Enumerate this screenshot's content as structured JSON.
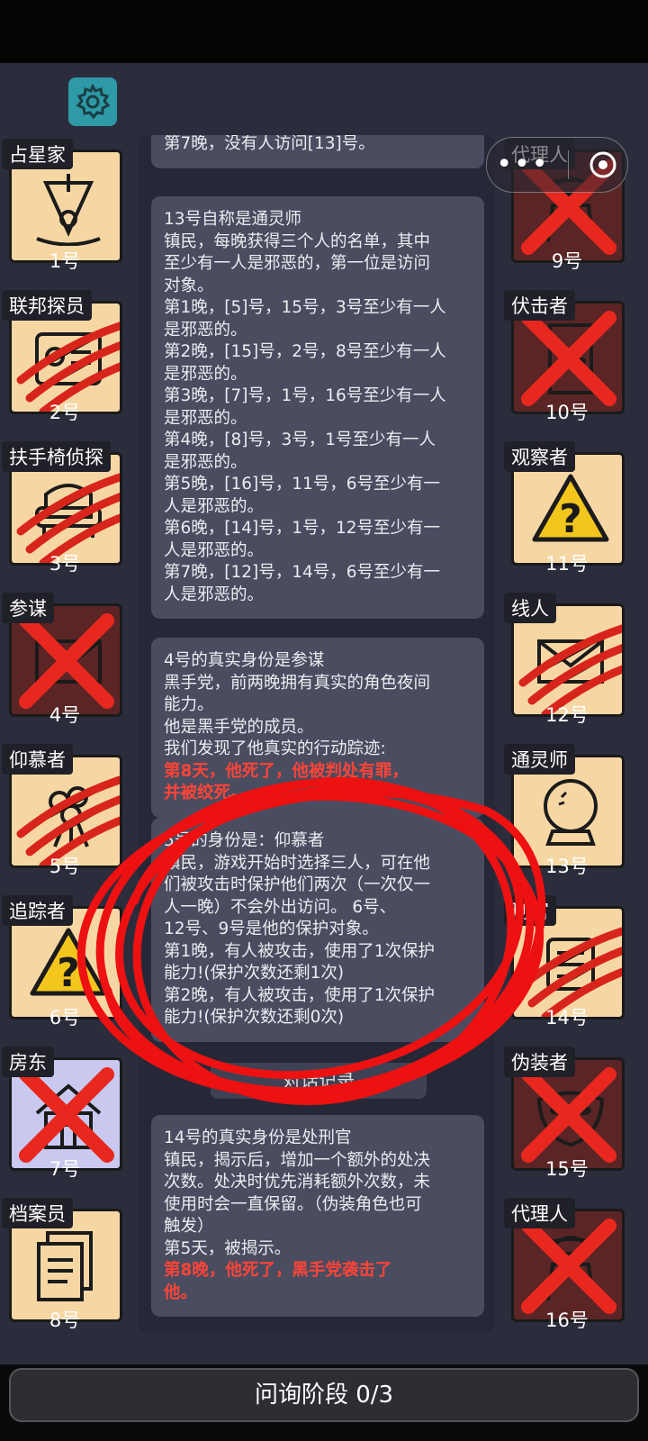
{
  "header": {
    "settings_icon": "gear-icon",
    "capsule_more": "•••",
    "capsule_close_icon": "target-close-icon"
  },
  "left_players": [
    {
      "role": "占星家",
      "number": "1号",
      "icon": "sextant-icon",
      "state": "alive"
    },
    {
      "role": "联邦探员",
      "number": "2号",
      "icon": "id-card-icon",
      "state": "clawed"
    },
    {
      "role": "扶手椅侦探",
      "number": "3号",
      "icon": "armchair-icon",
      "state": "clawed"
    },
    {
      "role": "参谋",
      "number": "4号",
      "icon": "envelope-icon",
      "state": "dead"
    },
    {
      "role": "仰慕者",
      "number": "5号",
      "icon": "flowers-icon",
      "state": "clawed"
    },
    {
      "role": "追踪者",
      "number": "6号",
      "icon": "warning-icon",
      "state": "alive"
    },
    {
      "role": "房东",
      "number": "7号",
      "icon": "house-icon",
      "state": "dead"
    },
    {
      "role": "档案员",
      "number": "8号",
      "icon": "documents-icon",
      "state": "alive"
    }
  ],
  "right_players": [
    {
      "role": "代理人",
      "number": "9号",
      "icon": "agent-icon",
      "state": "dead"
    },
    {
      "role": "伏击者",
      "number": "10号",
      "icon": "door-icon",
      "state": "dead"
    },
    {
      "role": "观察者",
      "number": "11号",
      "icon": "warning-icon",
      "state": "alive"
    },
    {
      "role": "线人",
      "number": "12号",
      "icon": "envelope-icon",
      "state": "clawed"
    },
    {
      "role": "通灵师",
      "number": "13号",
      "icon": "crystal-ball-icon",
      "state": "alive"
    },
    {
      "role": "刑官",
      "number": "14号",
      "icon": "scroll-icon",
      "state": "clawed"
    },
    {
      "role": "伪装者",
      "number": "15号",
      "icon": "mask-icon",
      "state": "dead"
    },
    {
      "role": "代理人",
      "number": "16号",
      "icon": "agent-icon",
      "state": "dead"
    }
  ],
  "log": {
    "msg0": {
      "lines": [
        "第7晚，没有人访问[13]号。"
      ]
    },
    "msg1": {
      "lines": [
        "13号自称是通灵师",
        "镇民，每晚获得三个人的名单，其中",
        "至少有一人是邪恶的，第一位是访问",
        "对象。",
        "第1晚，[5]号，15号，3号至少有一人",
        "是邪恶的。",
        "第2晚，[15]号，2号，8号至少有一人",
        "是邪恶的。",
        "第3晚，[7]号，1号，16号至少有一人",
        "是邪恶的。",
        "第4晚，[8]号，3号，1号至少有一人",
        "是邪恶的。",
        "第5晚，[16]号，11号，6号至少有一",
        "人是邪恶的。",
        "第6晚，[14]号，1号，12号至少有一",
        "人是邪恶的。",
        "第7晚，[12]号，14号，6号至少有一",
        "人是邪恶的。"
      ]
    },
    "msg2": {
      "lines": [
        "4号的真实身份是参谋",
        "黑手党，前两晚拥有真实的角色夜间",
        "能力。",
        "他是黑手党的成员。",
        "我们发现了他真实的行动踪迹:"
      ],
      "red_lines": [
        "第8天，他死了，他被判处有罪，",
        "并被绞死。"
      ]
    },
    "msg3": {
      "lines": [
        "5号的身份是：仰慕者",
        "镇民，游戏开始时选择三人，可在他",
        "们被攻击时保护他们两次（一次仅一",
        "人一晚）不会外出访问。 6号、",
        "12号、9号是他的保护对象。",
        "第1晚，有人被攻击，使用了1次保护",
        "能力!(保护次数还剩1次)",
        "第2晚，有人被攻击，使用了1次保护",
        "能力!(保护次数还剩0次)"
      ]
    },
    "hidden_tab": "对话记录",
    "msg4": {
      "lines": [
        "14号的真实身份是处刑官",
        "镇民，揭示后，增加一个额外的处决",
        "次数。处决时优先消耗额外次数，未",
        "使用时会一直保留。（伪装角色也可",
        "触发）",
        "第5天，被揭示。"
      ],
      "red_lines": [
        "第8晚，他死了，黑手党袭击了",
        "他。"
      ]
    }
  },
  "footer": {
    "phase_label": "问询阶段 0/3"
  },
  "colors": {
    "accent_teal": "#2e9aa6",
    "card_bg": "#f6d7a4",
    "dead_bg": "#5b2526",
    "red_mark": "#e8281f"
  }
}
